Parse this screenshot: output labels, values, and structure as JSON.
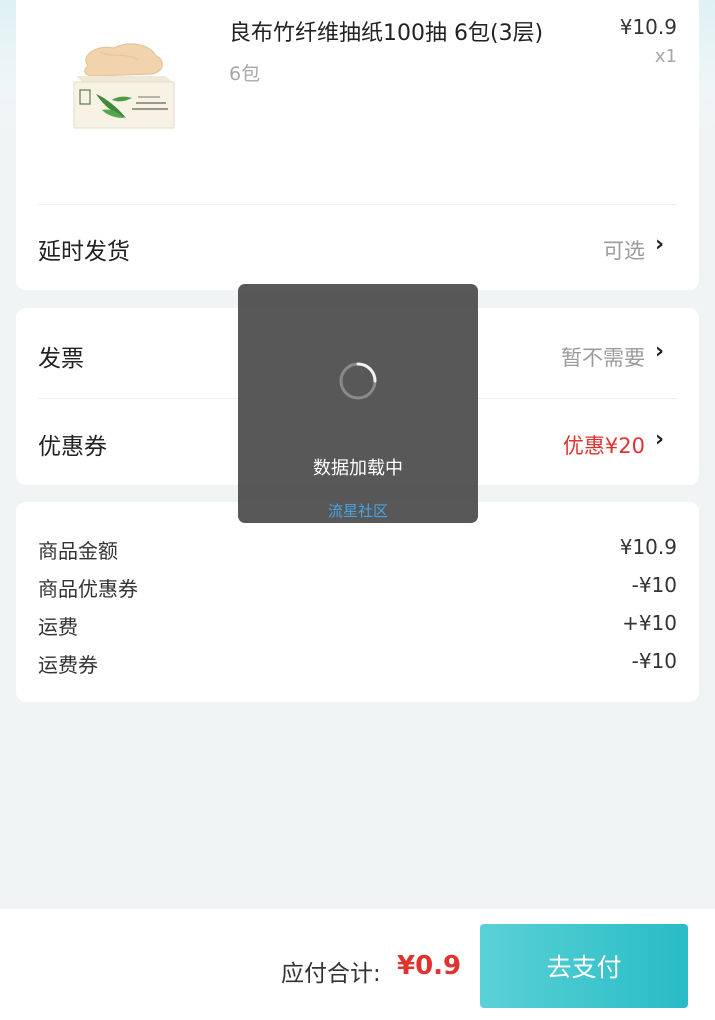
{
  "product": {
    "name": "良布竹纤维抽纸100抽 6包(3层)",
    "spec": "6包",
    "price": "¥10.9",
    "quantity": "x1",
    "image_icon": "tissue-box-image"
  },
  "delay_shipping": {
    "label": "延时发货",
    "value": "可选"
  },
  "invoice": {
    "label": "发票",
    "value": "暂不需要"
  },
  "coupon": {
    "label": "优惠券",
    "value": "优惠¥20"
  },
  "summary": {
    "rows": [
      {
        "label": "商品金额",
        "value": "¥10.9"
      },
      {
        "label": "商品优惠券",
        "value": "-¥10"
      },
      {
        "label": "运费",
        "value": "+¥10"
      },
      {
        "label": "运费券",
        "value": "-¥10"
      }
    ]
  },
  "footer": {
    "total_label": "应付合计:",
    "total_amount": "¥0.9",
    "pay_button": "去支付"
  },
  "loading_toast": {
    "text": "数据加载中",
    "watermark": "流星社区"
  },
  "colors": {
    "accent": "#28bcc6",
    "price_red": "#e0322e",
    "toast_bg": "#464646"
  }
}
